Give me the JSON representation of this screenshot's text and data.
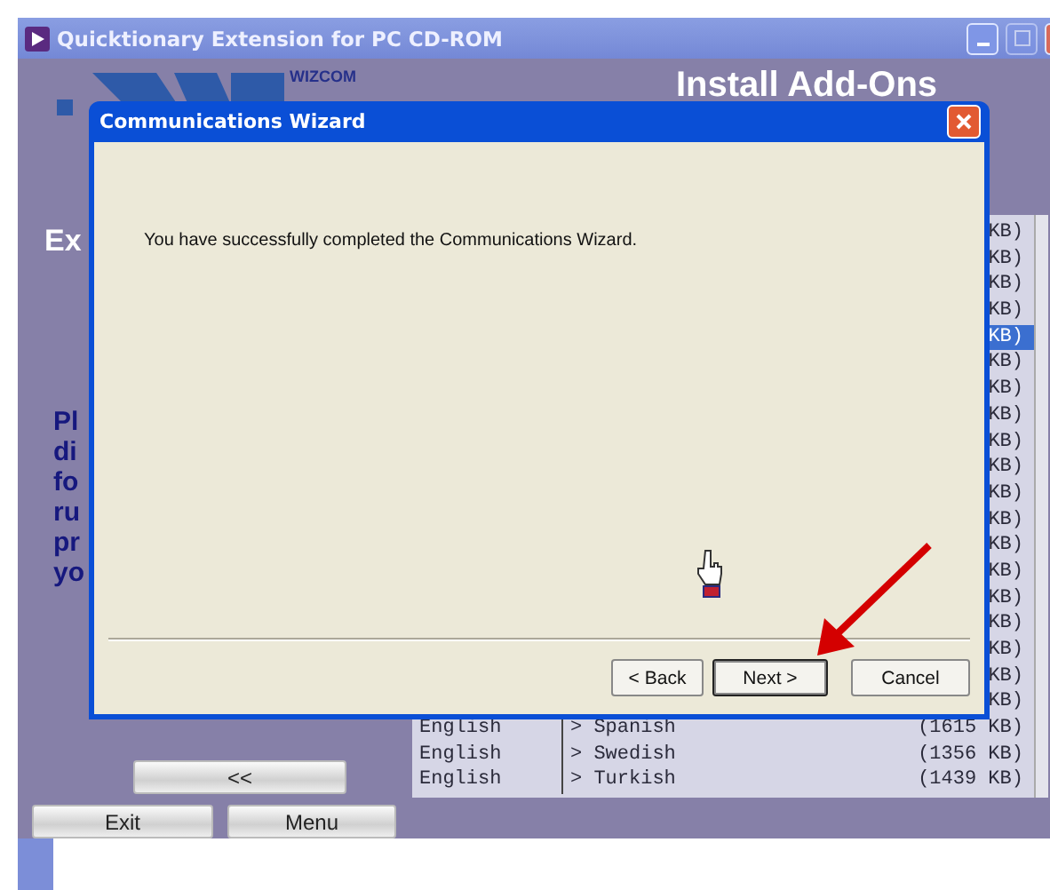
{
  "window": {
    "title": "Quicktionary Extension for PC CD-ROM"
  },
  "header": {
    "brand": "WIZCOM",
    "title": "Install Add-Ons"
  },
  "left_panel": {
    "heading": "Ex",
    "lines": [
      "Pl",
      "di",
      "fo",
      "ru",
      "pr",
      "yo"
    ]
  },
  "list": [
    {
      "size": "KB)",
      "selected": false
    },
    {
      "size": "KB)",
      "selected": false
    },
    {
      "size": "KB)",
      "selected": false
    },
    {
      "size": "KB)",
      "selected": false
    },
    {
      "size": "KB)",
      "selected": true
    },
    {
      "size": "KB)",
      "selected": false
    },
    {
      "size": "KB)",
      "selected": false
    },
    {
      "size": "KB)",
      "selected": false
    },
    {
      "size": "KB)",
      "selected": false
    },
    {
      "size": "KB)",
      "selected": false
    },
    {
      "size": "KB)",
      "selected": false
    },
    {
      "size": "KB)",
      "selected": false
    },
    {
      "size": "KB)",
      "selected": false
    },
    {
      "size": "KB)",
      "selected": false
    },
    {
      "size": "KB)",
      "selected": false
    },
    {
      "size": "KB)",
      "selected": false
    },
    {
      "size": "KB)",
      "selected": false
    },
    {
      "size": "KB)",
      "selected": false
    },
    {
      "size": "KB)",
      "selected": false
    },
    {
      "from": "English",
      "to": "> Spanish",
      "size": "(1615 KB)",
      "selected": false
    },
    {
      "from": "English",
      "to": "> Swedish",
      "size": "(1356 KB)",
      "selected": false
    },
    {
      "from": "English",
      "to": "> Turkish",
      "size": "(1439 KB)",
      "selected": false
    }
  ],
  "back_button": "<<",
  "footer_buttons": [
    "Exit",
    "Menu"
  ],
  "dialog": {
    "title": "Communications Wizard",
    "message": "You have successfully completed the Communications Wizard.",
    "buttons": [
      {
        "label": "< Back",
        "focused": false
      },
      {
        "label": "Next >",
        "focused": true
      },
      {
        "label": "Cancel",
        "focused": false
      }
    ]
  }
}
